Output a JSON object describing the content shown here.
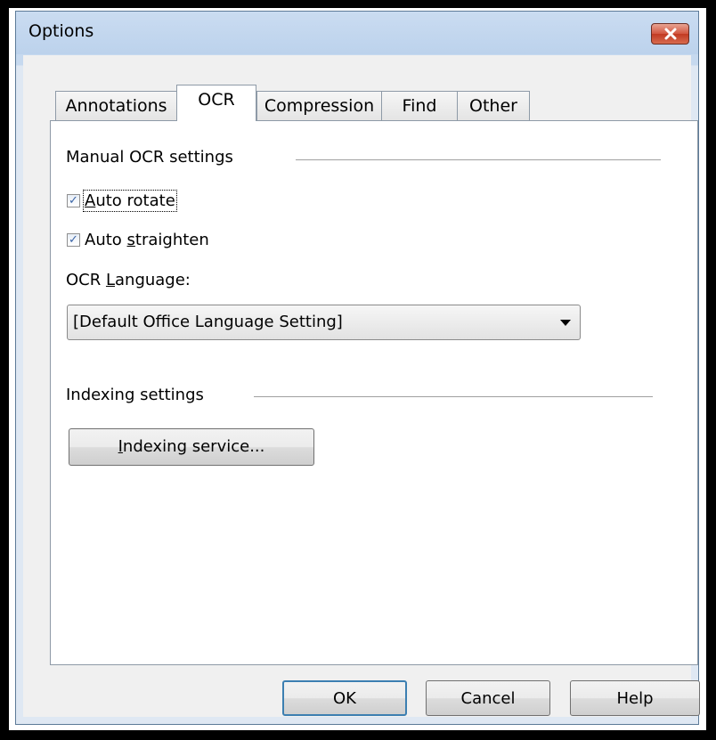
{
  "window": {
    "title": "Options",
    "close_icon": "close-icon"
  },
  "tabs": [
    {
      "label": "Annotations",
      "active": false
    },
    {
      "label": "OCR",
      "active": true
    },
    {
      "label": "Compression",
      "active": false
    },
    {
      "label": "Find",
      "active": false
    },
    {
      "label": "Other",
      "active": false
    }
  ],
  "manual_ocr": {
    "group_label": "Manual OCR settings",
    "auto_rotate": {
      "pre": "",
      "mnemonic": "A",
      "post": "uto rotate",
      "checked": true
    },
    "auto_straighten": {
      "pre": "Auto ",
      "mnemonic": "s",
      "post": "traighten",
      "checked": true
    },
    "language_label": {
      "pre": "OCR ",
      "mnemonic": "L",
      "post": "anguage:"
    },
    "language_value": "[Default Office Language Setting]"
  },
  "indexing": {
    "group_label": "Indexing settings",
    "button": {
      "pre": "",
      "mnemonic": "I",
      "post": "ndexing service..."
    }
  },
  "footer": {
    "ok_label": "OK",
    "cancel_label": "Cancel",
    "help_label": "Help"
  },
  "colors": {
    "title_bar": "#c6d9ef",
    "close_button": "#c13a22",
    "default_button_border": "#3c7fb1",
    "check_mark": "#3a64a6"
  }
}
